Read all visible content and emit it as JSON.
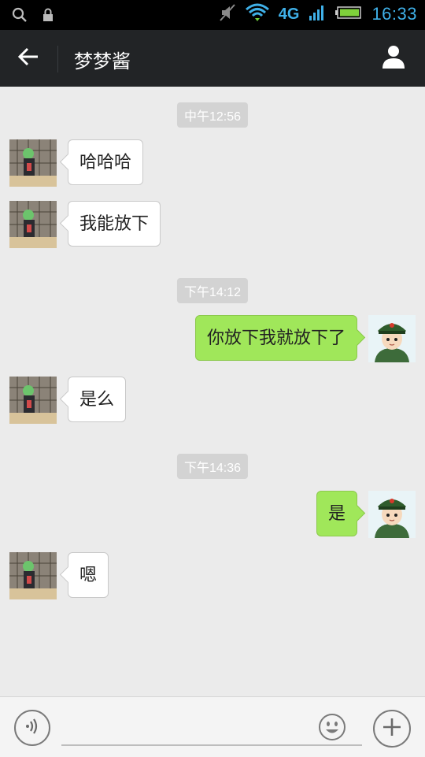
{
  "status_bar": {
    "network": "4G",
    "time": "16:33",
    "icons": [
      "search-icon",
      "lock-icon",
      "mute-icon",
      "wifi-icon",
      "signal-icon",
      "battery-icon"
    ]
  },
  "header": {
    "title": "梦梦酱",
    "icons": [
      "back-arrow-icon",
      "contact-profile-icon"
    ]
  },
  "chat": {
    "timestamps": [
      "中午12:56",
      "下午14:12",
      "下午14:36"
    ],
    "messages": [
      {
        "side": "in",
        "text": "哈哈哈"
      },
      {
        "side": "in",
        "text": "我能放下"
      },
      {
        "side": "out",
        "text": "你放下我就放下了"
      },
      {
        "side": "in",
        "text": "是么"
      },
      {
        "side": "out",
        "text": "是"
      },
      {
        "side": "in",
        "text": "嗯"
      }
    ]
  },
  "input_bar": {
    "message_value": "",
    "placeholder": "",
    "icons": [
      "voice-icon",
      "emoji-icon",
      "plus-icon"
    ]
  },
  "colors": {
    "status_bar_bg": "#000000",
    "accent": "#3fb0e8",
    "title_bar_bg": "#222426",
    "chat_bg": "#ebebeb",
    "incoming_bubble": "#ffffff",
    "outgoing_bubble": "#a0e75a",
    "timestamp_bg": "#d3d3d3"
  }
}
